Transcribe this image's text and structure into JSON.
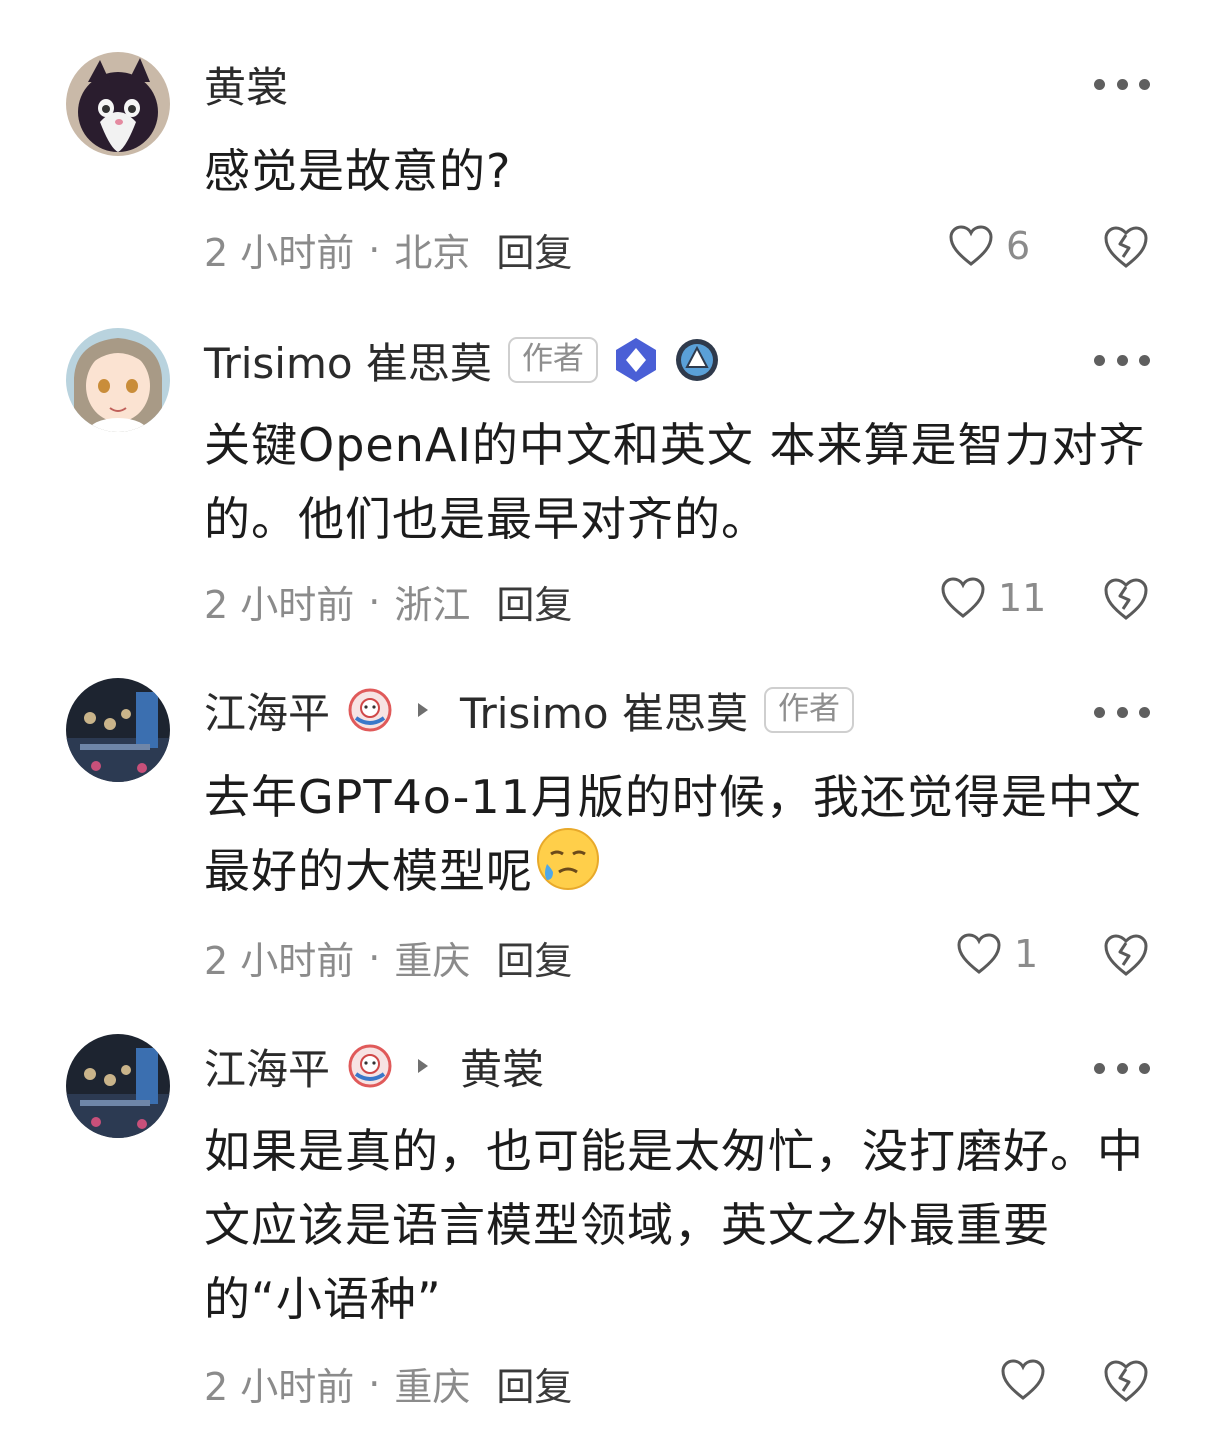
{
  "comments": [
    {
      "name": "黄裳",
      "text": "感觉是故意的?",
      "time": "2 小时前",
      "location": "北京",
      "reply_label": "回复",
      "likes": "6"
    },
    {
      "name": "Trisimo 崔思莫",
      "author_tag": "作者",
      "text": "关键OpenAI的中文和英文 本来算是智力对齐的。他们也是最早对齐的。",
      "time": "2 小时前",
      "location": "浙江",
      "reply_label": "回复",
      "likes": "11"
    },
    {
      "name": "江海平",
      "reply_to": "Trisimo 崔思莫",
      "author_tag": "作者",
      "text": "去年GPT4o-11月版的时候，我还觉得是中文最好的大模型呢",
      "emoji": "crying-face-emoji",
      "time": "2 小时前",
      "location": "重庆",
      "reply_label": "回复",
      "likes": "1"
    },
    {
      "name": "江海平",
      "reply_to": "黄裳",
      "text": "如果是真的，也可能是太匆忙，没打磨好。中文应该是语言模型领域，英文之外最重要的“小语种”",
      "time": "2 小时前",
      "location": "重庆",
      "reply_label": "回复",
      "likes": ""
    }
  ],
  "icons": {
    "more": "more-dots-icon",
    "like": "heart-icon",
    "dislike": "broken-heart-icon",
    "arrow": "triangle-right-icon"
  },
  "colors": {
    "text": "#1c1c1c",
    "meta": "#8b8b8b",
    "badge_blue": "#4a5fd6"
  }
}
